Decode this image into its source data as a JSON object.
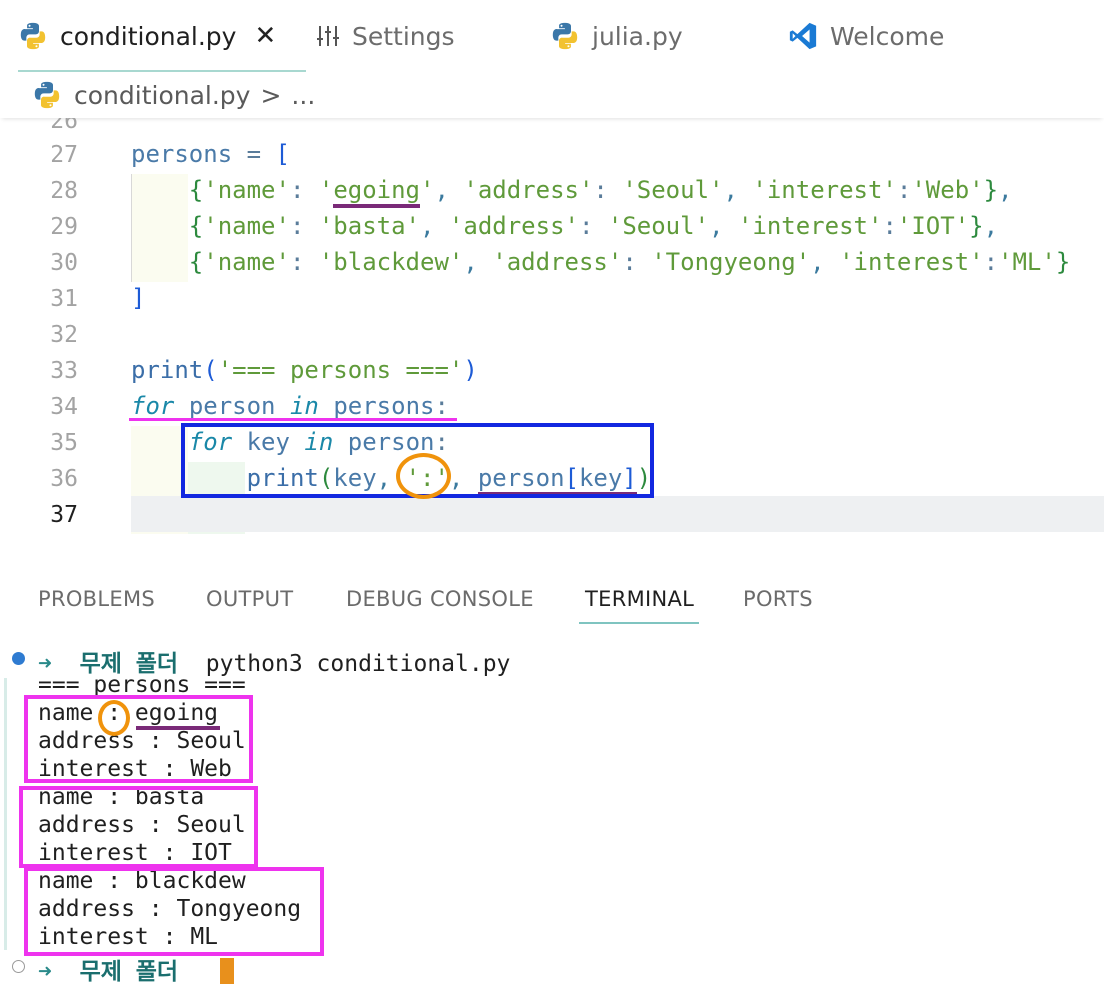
{
  "tabs": [
    {
      "label": "conditional.py",
      "icon": "python-icon",
      "active": true,
      "close": "✕"
    },
    {
      "label": "Settings",
      "icon": "settings-icon",
      "active": false
    },
    {
      "label": "julia.py",
      "icon": "python-icon",
      "active": false
    },
    {
      "label": "Welcome",
      "icon": "vscode-icon",
      "active": false
    }
  ],
  "breadcrumb": {
    "file": "conditional.py",
    "separator": ">",
    "ellipsis": "..."
  },
  "editor": {
    "line_numbers": [
      "26",
      "27",
      "28",
      "29",
      "30",
      "31",
      "32",
      "33",
      "34",
      "35",
      "36",
      "37"
    ],
    "current_line": "37"
  },
  "panel": {
    "tabs": [
      "PROBLEMS",
      "OUTPUT",
      "DEBUG CONSOLE",
      "TERMINAL",
      "PORTS"
    ],
    "active": "TERMINAL"
  },
  "terminal": {
    "prompt_arrow": "➜",
    "prompt_dir": "무제 폴더",
    "command": "python3 conditional.py",
    "output": [
      "=== persons ===",
      "name : egoing",
      "address : Seoul",
      "interest : Web",
      "name : basta",
      "address : Seoul",
      "interest : IOT",
      "name : blackdew",
      "address : Tongyeong",
      "interest : ML"
    ]
  },
  "colors": {
    "annotation_pink": "#ee33ee",
    "annotation_blue": "#1228e0",
    "annotation_orange": "#f0930c",
    "annotation_purple": "#7a2a78"
  }
}
